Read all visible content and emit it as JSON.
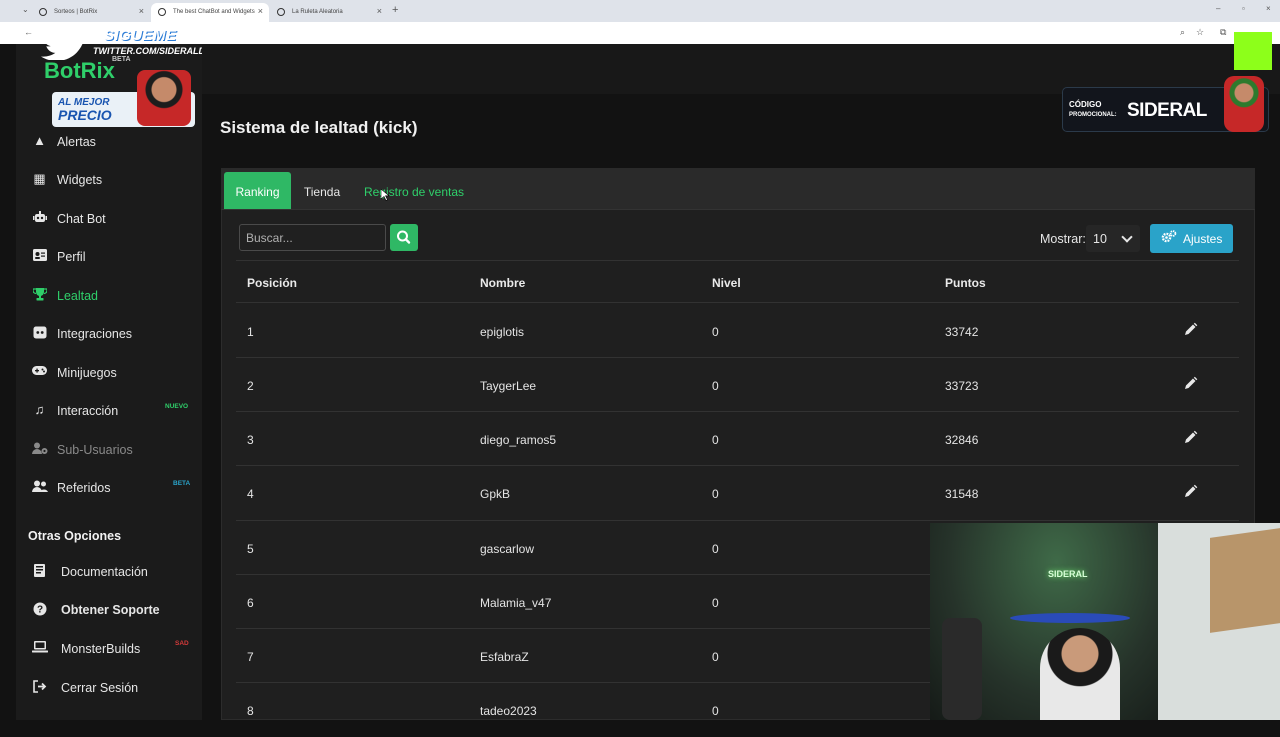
{
  "browser": {
    "tabs": [
      {
        "title": "Sorteos | BotRix"
      },
      {
        "title": "The best ChatBot and Widgets"
      },
      {
        "title": "La Ruleta Aleatoria"
      }
    ]
  },
  "overlay": {
    "sigueme": "SIGUEME",
    "twitter_url": "TWITTER.COM/SIDERALDOTA",
    "promo_line1": "AL MEJOR",
    "promo_line2": "PRECIO",
    "codigo_line1": "CÓDIGO",
    "codigo_line2": "PROMOCIONAL:",
    "codigo_brand": "SIDERAL",
    "cam_neon": "SIDERAL"
  },
  "brand": {
    "name": "BotRix",
    "badge": "BETA"
  },
  "sidebar": {
    "items": [
      {
        "label": "Alertas",
        "icon": "warning-icon"
      },
      {
        "label": "Widgets",
        "icon": "grid-icon"
      },
      {
        "label": "Chat Bot",
        "icon": "robot-icon"
      },
      {
        "label": "Perfil",
        "icon": "id-card-icon"
      },
      {
        "label": "Lealtad",
        "icon": "trophy-icon",
        "active": true
      },
      {
        "label": "Integraciones",
        "icon": "discord-icon"
      },
      {
        "label": "Minijuegos",
        "icon": "gamepad-icon"
      },
      {
        "label": "Interacción",
        "icon": "music-icon",
        "tag": "NUEVO"
      },
      {
        "label": "Sub-Usuarios",
        "icon": "users-cog-icon",
        "disabled": true
      },
      {
        "label": "Referidos",
        "icon": "users-icon",
        "tag": "BETA"
      }
    ],
    "section_title": "Otras Opciones",
    "other_items": [
      {
        "label": "Documentación",
        "icon": "book-icon"
      },
      {
        "label": "Obtener Soporte",
        "icon": "question-icon"
      },
      {
        "label": "MonsterBuilds",
        "icon": "laptop-icon",
        "tag": "SAD"
      },
      {
        "label": "Cerrar Sesión",
        "icon": "sign-out-icon"
      }
    ]
  },
  "main": {
    "title": "Sistema de lealtad (kick)",
    "tabs": [
      {
        "label": "Ranking",
        "active": true
      },
      {
        "label": "Tienda"
      },
      {
        "label": "Registro de ventas"
      }
    ],
    "search_placeholder": "Buscar...",
    "show_label": "Mostrar:",
    "show_value": "10",
    "settings_label": "Ajustes",
    "columns": [
      "Posición",
      "Nombre",
      "Nivel",
      "Puntos"
    ],
    "rows": [
      {
        "pos": "1",
        "name": "epiglotis",
        "level": "0",
        "points": "33742"
      },
      {
        "pos": "2",
        "name": "TaygerLee",
        "level": "0",
        "points": "33723"
      },
      {
        "pos": "3",
        "name": "diego_ramos5",
        "level": "0",
        "points": "32846"
      },
      {
        "pos": "4",
        "name": "GpkB",
        "level": "0",
        "points": "31548"
      },
      {
        "pos": "5",
        "name": "gascarlow",
        "level": "0",
        "points": ""
      },
      {
        "pos": "6",
        "name": "Malamia_v47",
        "level": "0",
        "points": ""
      },
      {
        "pos": "7",
        "name": "EsfabraZ",
        "level": "0",
        "points": ""
      },
      {
        "pos": "8",
        "name": "tadeo2023",
        "level": "0",
        "points": ""
      }
    ]
  },
  "colors": {
    "accent_green": "#2fb865",
    "active_text_green": "#2fcf6a",
    "settings_blue": "#2aa3c9",
    "background": "#121212",
    "panel": "#1f1f1f"
  }
}
